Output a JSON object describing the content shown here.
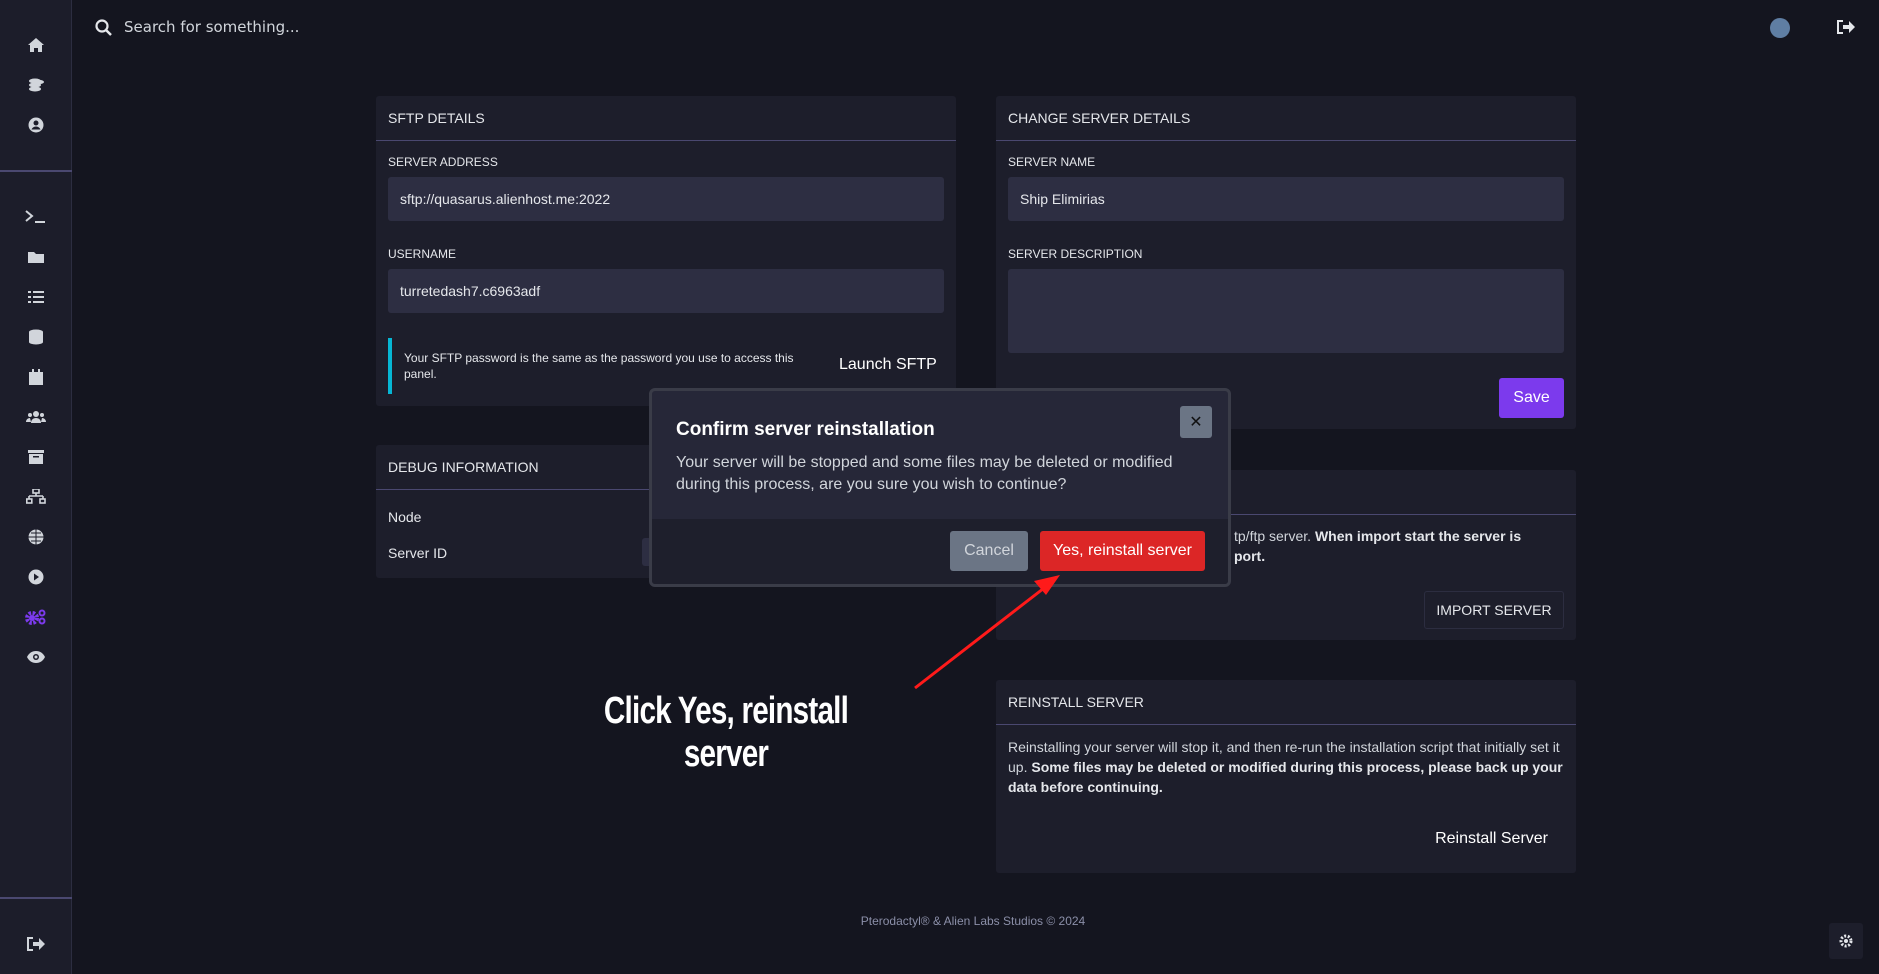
{
  "colors": {
    "accent": "#7c3aed",
    "danger": "#dc2626",
    "info": "#06b6d4",
    "background": "#14151f",
    "panel": "#1d1e2b"
  },
  "header": {
    "search_placeholder": "Search for something...",
    "search_icon": "search-icon",
    "avatar_icon": "avatar-icon",
    "logout_icon": "logout-icon"
  },
  "sidebar": {
    "top_items": [
      {
        "icon": "home-icon"
      },
      {
        "icon": "coins-icon"
      },
      {
        "icon": "user-circle-icon"
      }
    ],
    "server_items": [
      {
        "icon": "terminal-icon"
      },
      {
        "icon": "folder-icon"
      },
      {
        "icon": "tasks-icon"
      },
      {
        "icon": "database-icon"
      },
      {
        "icon": "calendar-icon"
      },
      {
        "icon": "users-icon"
      },
      {
        "icon": "archive-icon"
      },
      {
        "icon": "network-icon"
      },
      {
        "icon": "globe-icon"
      },
      {
        "icon": "play-icon"
      },
      {
        "icon": "cogs-icon",
        "active": true
      },
      {
        "icon": "eye-icon"
      }
    ],
    "bottom_items": [
      {
        "icon": "logout-icon"
      }
    ]
  },
  "sftp": {
    "title": "SFTP DETAILS",
    "address_label": "SERVER ADDRESS",
    "address_value": "sftp://quasarus.alienhost.me:2022",
    "username_label": "USERNAME",
    "username_value": "turretedash7.c6963adf",
    "note": "Your SFTP password is the same as the password you use to access this panel.",
    "launch_label": "Launch SFTP"
  },
  "debug": {
    "title": "DEBUG INFORMATION",
    "node_label": "Node",
    "server_id_label": "Server ID"
  },
  "change": {
    "title": "CHANGE SERVER DETAILS",
    "name_label": "SERVER NAME",
    "name_value": "Ship Elimirias",
    "desc_label": "SERVER DESCRIPTION",
    "desc_value": "",
    "save_label": "Save"
  },
  "import": {
    "text_plain": "tp/ftp server. ",
    "text_bold": "When import start the server is",
    "text_line2": "port.",
    "button": "IMPORT SERVER"
  },
  "reinstall": {
    "title": "REINSTALL SERVER",
    "text_plain": "Reinstalling your server will stop it, and then re-run the installation script that initially set it up. ",
    "text_bold": "Some files may be deleted or modified during this process, please back up your data before continuing.",
    "button": "Reinstall Server"
  },
  "modal": {
    "title": "Confirm server reinstallation",
    "body": "Your server will be stopped and some files may be deleted or modified during this process, are you sure you wish to continue?",
    "close_label": "✕",
    "cancel_label": "Cancel",
    "confirm_label": "Yes, reinstall server"
  },
  "annotation": {
    "text": "Click Yes, reinstall server"
  },
  "footer": {
    "text": "Pterodactyl® & Alien Labs Studios © 2024"
  }
}
